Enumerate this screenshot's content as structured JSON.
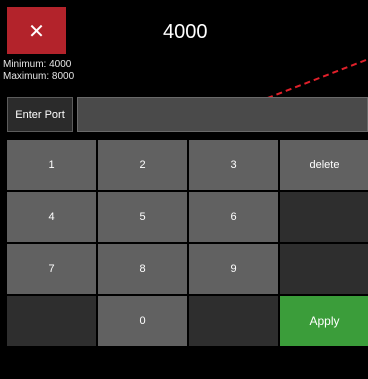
{
  "header": {
    "close_icon": "close-x-icon",
    "close_glyph": "✕",
    "value": "4000",
    "minimum_text": "Minimum: 4000",
    "maximum_text": "Maximum: 8000"
  },
  "input": {
    "label": "Enter Port",
    "value": ""
  },
  "keypad": {
    "keys": [
      "1",
      "2",
      "3",
      "delete",
      "4",
      "5",
      "6",
      "",
      "7",
      "8",
      "9",
      "",
      "",
      "0",
      "",
      "Apply"
    ]
  },
  "colors": {
    "close_button": "#b3232b",
    "key": "#616161",
    "key_blank": "#2e2e2e",
    "apply_button": "#3b9d3a",
    "annotation_arrow": "#e0202a"
  }
}
